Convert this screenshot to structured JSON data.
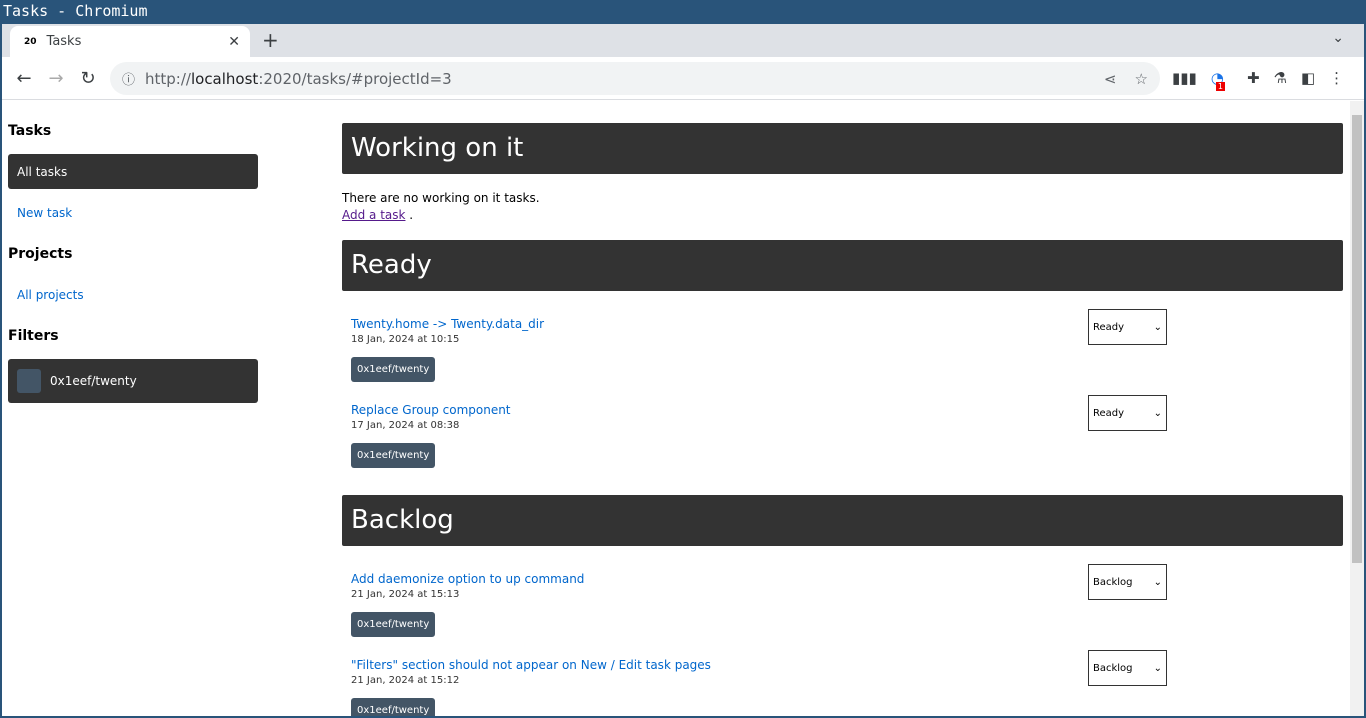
{
  "window": {
    "title": "Tasks - Chromium"
  },
  "browser": {
    "tab_title": "Tasks",
    "favicon": "20",
    "url_prefix": "http://",
    "url_host": "localhost",
    "url_rest": ":2020/tasks/#projectId=3",
    "extension_badge": "1"
  },
  "sidebar": {
    "tasks_heading": "Tasks",
    "all_tasks": "All tasks",
    "new_task": "New task",
    "projects_heading": "Projects",
    "all_projects": "All projects",
    "filters_heading": "Filters",
    "filter_project": "0x1eef/twenty"
  },
  "sections": [
    {
      "title": "Working on it",
      "empty_text": "There are no working on it tasks.",
      "add_link": "Add a task",
      "add_suffix": " ."
    },
    {
      "title": "Ready",
      "tasks": [
        {
          "title": "Twenty.home -> Twenty.data_dir",
          "date": "18 Jan, 2024 at 10:15",
          "tag": "0x1eef/twenty",
          "status": "Ready"
        },
        {
          "title": "Replace Group component",
          "date": "17 Jan, 2024 at 08:38",
          "tag": "0x1eef/twenty",
          "status": "Ready"
        }
      ]
    },
    {
      "title": "Backlog",
      "tasks": [
        {
          "title": "Add daemonize option to up command",
          "date": "21 Jan, 2024 at 15:13",
          "tag": "0x1eef/twenty",
          "status": "Backlog"
        },
        {
          "title": "\"Filters\" section should not appear on New / Edit task pages",
          "date": "21 Jan, 2024 at 15:12",
          "tag": "0x1eef/twenty",
          "status": "Backlog"
        }
      ]
    }
  ]
}
